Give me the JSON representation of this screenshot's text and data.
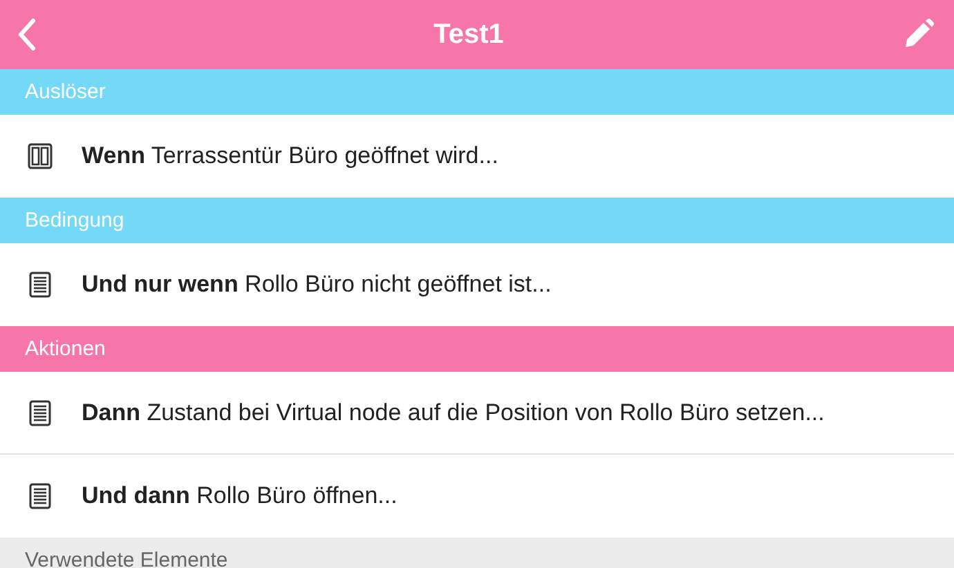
{
  "header": {
    "title": "Test1"
  },
  "sections": [
    {
      "title": "Auslöser",
      "color": "#74d9f7",
      "rows": [
        {
          "kind": "door",
          "text": "**Wenn** Terrassentür Büro geöffnet wird..."
        }
      ]
    },
    {
      "title": "Bedingung",
      "color": "#74d9f7",
      "rows": [
        {
          "kind": "list",
          "text": "**Und nur wenn** Rollo Büro nicht geöffnet ist..."
        }
      ]
    },
    {
      "title": "Aktionen",
      "color": "#f776a9",
      "rows": [
        {
          "kind": "list",
          "text": "**Dann** Zustand bei Virtual node auf die Position von Rollo Büro setzen..."
        },
        {
          "kind": "list",
          "text": "**Und dann** Rollo Büro öffnen..."
        }
      ]
    },
    {
      "title": "Verwendete Elemente",
      "color": "#ececec"
    }
  ]
}
